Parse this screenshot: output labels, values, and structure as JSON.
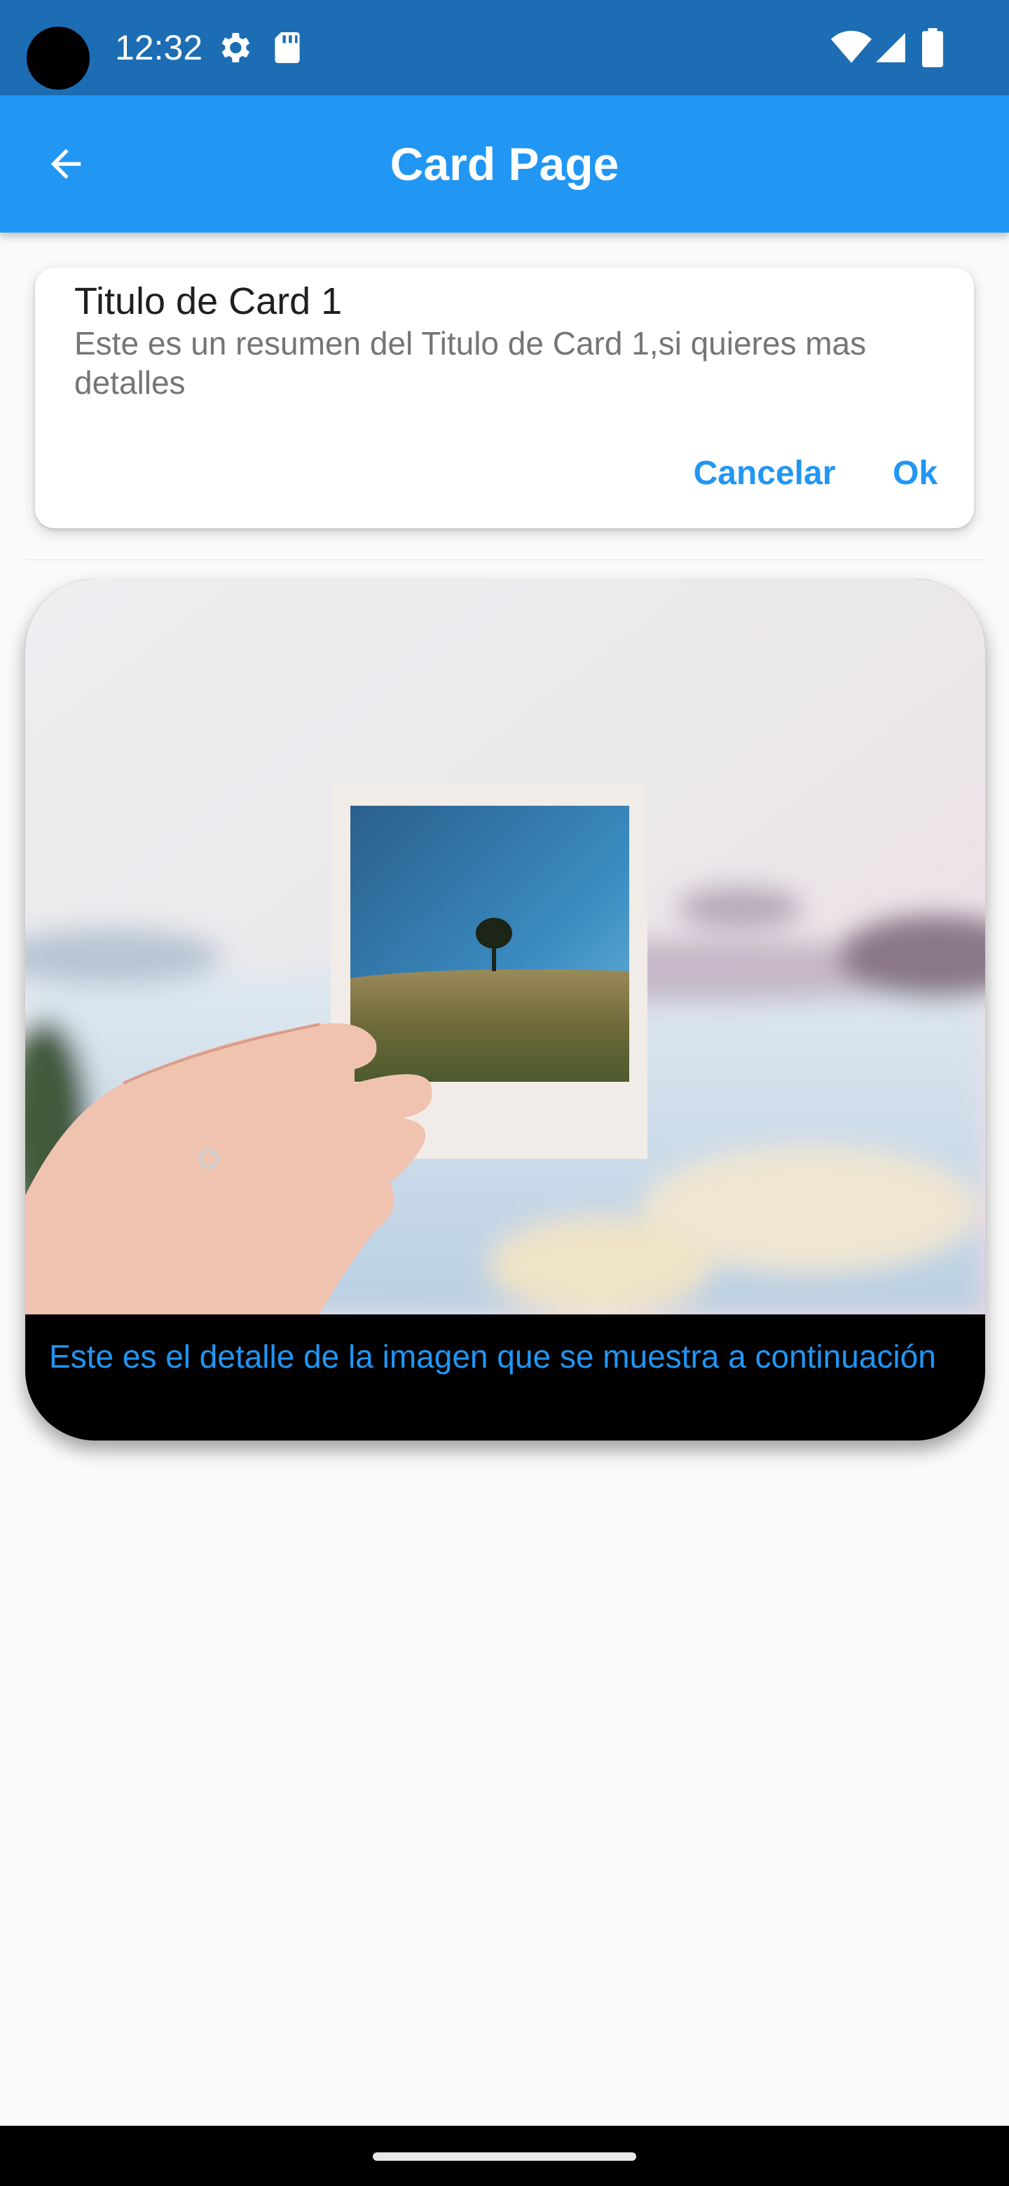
{
  "status_bar": {
    "time": "12:32",
    "icons": [
      "camera-cutout",
      "settings-gear-icon",
      "sd-card-icon",
      "wifi-icon",
      "cell-signal-icon",
      "battery-icon"
    ],
    "background": "#1c6db3"
  },
  "app_bar": {
    "title": "Card Page",
    "back_icon": "arrow-back-icon",
    "background": "#2196f3"
  },
  "card1": {
    "title": "Titulo de Card 1",
    "subtitle": "Este es un resumen del Titulo de Card 1,si quieres mas detalles",
    "cancel_label": "Cancelar",
    "ok_label": "Ok",
    "accent": "#2196f3"
  },
  "card2": {
    "image_icon": "polaroid-photo-image",
    "caption": "Este es el detalle de la imagen que se muestra a continuación"
  },
  "colors": {
    "primary": "#2196f3",
    "page_background": "#fafafa"
  }
}
